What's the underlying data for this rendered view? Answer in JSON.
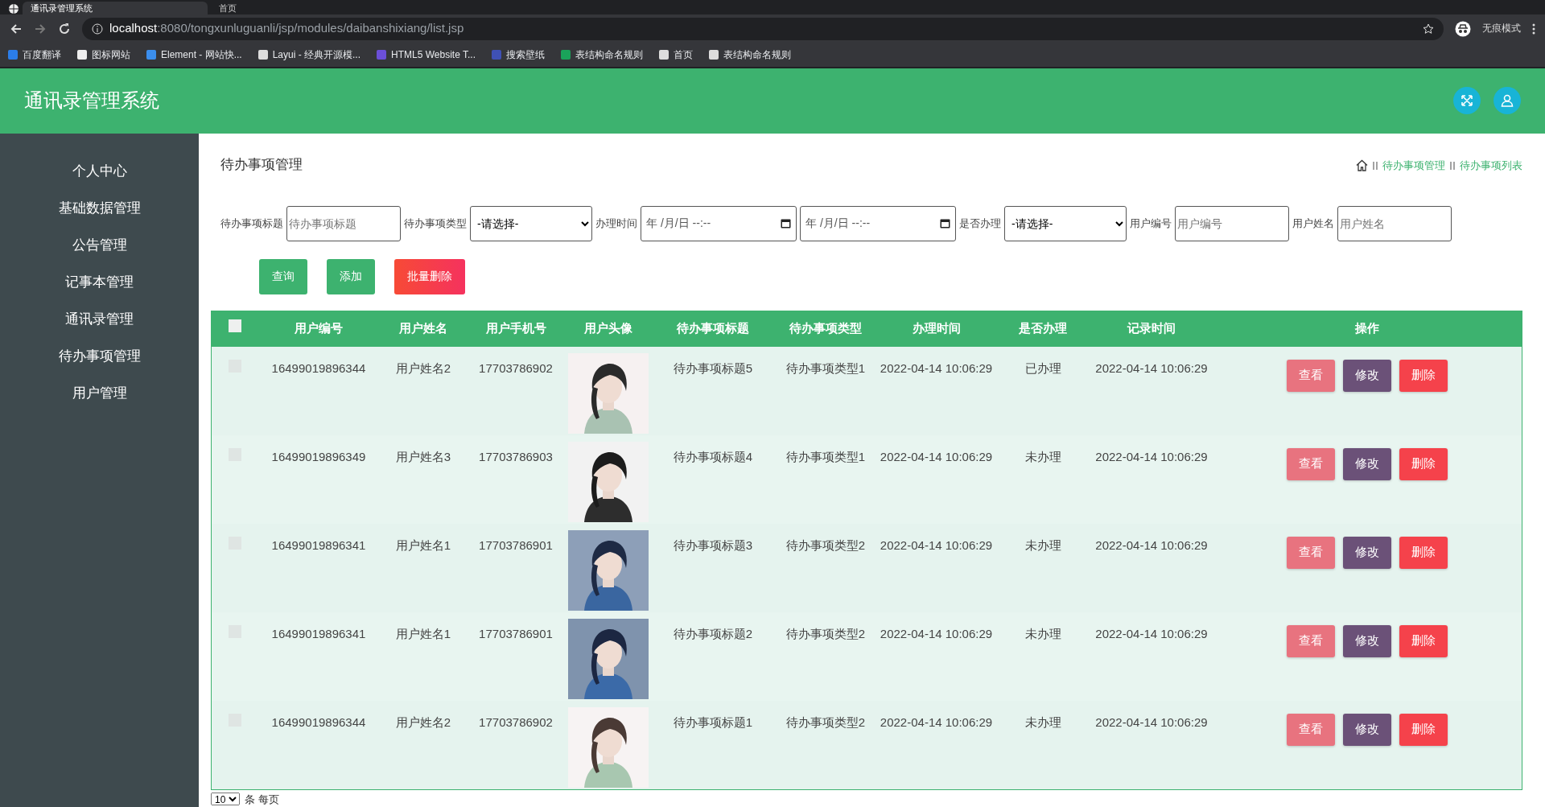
{
  "browser": {
    "tabs": [
      {
        "title": "通讯录管理系统",
        "selected": true
      },
      {
        "title": "首页",
        "selected": false
      }
    ],
    "url_host": "localhost",
    "url_path": ":8080/tongxunluguanli/jsp/modules/daibanshixiang/list.jsp",
    "incognito_label": "无痕模式",
    "bookmarks": [
      "百度翻译",
      "图标网站",
      "Element - 网站快...",
      "Layui - 经典开源模...",
      "HTML5 Website T...",
      "搜索壁纸",
      "表结构命名规则",
      "首页",
      "表结构命名规则"
    ]
  },
  "app": {
    "title": "通讯录管理系统"
  },
  "sidebar": {
    "items": [
      "个人中心",
      "基础数据管理",
      "公告管理",
      "记事本管理",
      "通讯录管理",
      "待办事项管理",
      "用户管理"
    ]
  },
  "page_title": "待办事项管理",
  "breadcrumb": [
    "待办事项管理",
    "待办事项列表"
  ],
  "filters": [
    {
      "kind": "text",
      "label": "待办事项标题",
      "placeholder": "待办事项标题"
    },
    {
      "kind": "select",
      "label": "待办事项类型",
      "value": "-请选择-"
    },
    {
      "kind": "datetime",
      "label": "办理时间",
      "value": "年 /月/日 --:--"
    },
    {
      "kind": "datetime",
      "value": "年 /月/日 --:--"
    },
    {
      "kind": "select",
      "label": "是否办理",
      "value": "-请选择-"
    },
    {
      "kind": "text",
      "label": "用户编号",
      "placeholder": "用户编号"
    },
    {
      "kind": "text",
      "label": "用户姓名",
      "placeholder": "用户姓名"
    }
  ],
  "actions": [
    {
      "kind": "search",
      "label": "查询"
    },
    {
      "kind": "add",
      "label": "添加"
    },
    {
      "kind": "delete",
      "label": "批量删除"
    }
  ],
  "table": {
    "select_all_checked": false,
    "columns": [
      "用户编号",
      "用户姓名",
      "用户手机号",
      "用户头像",
      "待办事项标题",
      "待办事项类型",
      "办理时间",
      "是否办理",
      "记录时间",
      "操作"
    ],
    "rows": [
      {
        "checked": false,
        "cells": [
          "16499019896344",
          "用户姓名2",
          "17703786902",
          {
            "kind": "picture"
          },
          "待办事项标题5",
          "待办事项类型1",
          "2022-04-14 10:06:29",
          "已办理",
          "2022-04-14 10:06:29"
        ],
        "buttons": [
          {
            "kind": "view",
            "label": "查看"
          },
          {
            "kind": "edit",
            "label": "修改"
          },
          {
            "kind": "delete",
            "label": "删除"
          }
        ]
      },
      {
        "checked": false,
        "cells": [
          "16499019896349",
          "用户姓名3",
          "17703786903",
          {
            "kind": "picture"
          },
          "待办事项标题4",
          "待办事项类型1",
          "2022-04-14 10:06:29",
          "未办理",
          "2022-04-14 10:06:29"
        ],
        "buttons": [
          {
            "kind": "view",
            "label": "查看"
          },
          {
            "kind": "edit",
            "label": "修改"
          },
          {
            "kind": "delete",
            "label": "删除"
          }
        ]
      },
      {
        "checked": false,
        "cells": [
          "16499019896341",
          "用户姓名1",
          "17703786901",
          {
            "kind": "picture"
          },
          "待办事项标题3",
          "待办事项类型2",
          "2022-04-14 10:06:29",
          "未办理",
          "2022-04-14 10:06:29"
        ],
        "buttons": [
          {
            "kind": "view",
            "label": "查看"
          },
          {
            "kind": "edit",
            "label": "修改"
          },
          {
            "kind": "delete",
            "label": "删除"
          }
        ]
      },
      {
        "checked": false,
        "cells": [
          "16499019896341",
          "用户姓名1",
          "17703786901",
          {
            "kind": "picture"
          },
          "待办事项标题2",
          "待办事项类型2",
          "2022-04-14 10:06:29",
          "未办理",
          "2022-04-14 10:06:29"
        ],
        "buttons": [
          {
            "kind": "view",
            "label": "查看"
          },
          {
            "kind": "edit",
            "label": "修改"
          },
          {
            "kind": "delete",
            "label": "删除"
          }
        ]
      },
      {
        "checked": false,
        "cells": [
          "16499019896344",
          "用户姓名2",
          "17703786902",
          {
            "kind": "picture"
          },
          "待办事项标题1",
          "待办事项类型2",
          "2022-04-14 10:06:29",
          "未办理",
          "2022-04-14 10:06:29"
        ],
        "buttons": [
          {
            "kind": "view",
            "label": "查看"
          },
          {
            "kind": "edit",
            "label": "修改"
          },
          {
            "kind": "delete",
            "label": "删除"
          }
        ]
      }
    ]
  },
  "pagination": {
    "page_size": "10",
    "label": "条 每页"
  }
}
